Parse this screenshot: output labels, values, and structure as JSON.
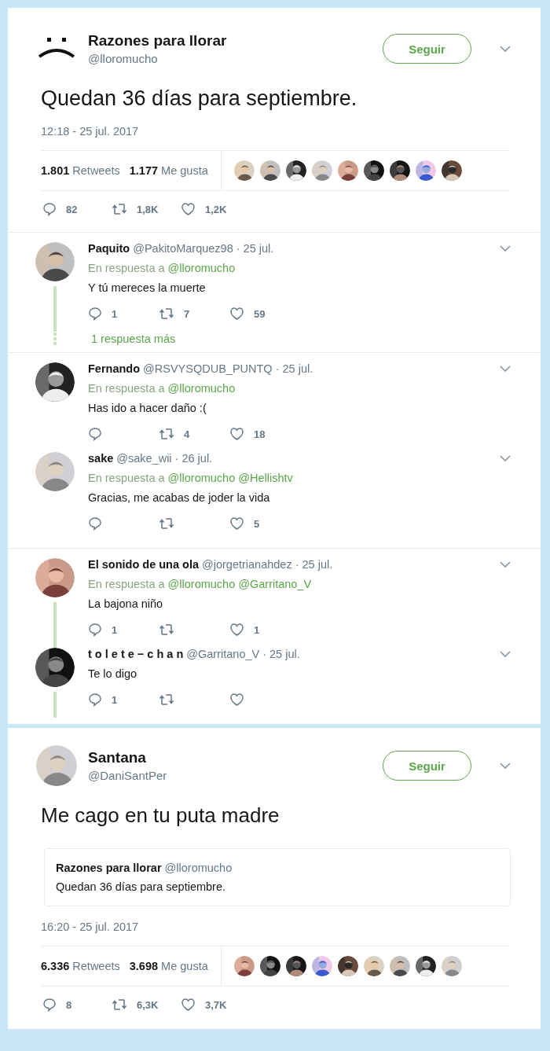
{
  "main_tweet": {
    "name": "Razones para llorar",
    "handle": "@lloromucho",
    "follow_button": "Seguir",
    "avatar": {
      "kind": "sad-face"
    },
    "text": "Quedan 36 días para septiembre.",
    "timestamp": "12:18 - 25 jul. 2017",
    "retweets_count": "1.801",
    "retweets_label": "Retweets",
    "likes_count": "1.177",
    "likes_label": "Me gusta",
    "actions": {
      "replies": "82",
      "retweets": "1,8K",
      "likes": "1,2K"
    }
  },
  "reply_groups": [
    {
      "tweets": [
        {
          "name": "Paquito",
          "handle": "@PakitoMarquez98",
          "date": "· 25 jul.",
          "reply_to_label": "En respuesta a",
          "reply_to": [
            "@lloromucho"
          ],
          "text": "Y tú mereces la muerte",
          "actions": {
            "replies": "1",
            "retweets": "7",
            "likes": "59"
          },
          "thread_line": true
        }
      ],
      "more_replies": "1 respuesta más"
    },
    {
      "tweets": [
        {
          "name": "Fernando",
          "handle": "@RSVYSQDUB_PUNTQ",
          "date": "· 25 jul.",
          "reply_to_label": "En respuesta a",
          "reply_to": [
            "@lloromucho"
          ],
          "text": "Has ido a hacer daño :(",
          "actions": {
            "retweets": "4",
            "likes": "18"
          },
          "thread_line": false
        },
        {
          "name": "sake",
          "handle": "@sake_wii",
          "date": "· 26 jul.",
          "reply_to_label": "En respuesta a",
          "reply_to": [
            "@lloromucho",
            "@Hellishtv"
          ],
          "text": "Gracias, me acabas de joder la vida",
          "actions": {
            "likes": "5"
          },
          "thread_line": false
        }
      ]
    },
    {
      "tweets": [
        {
          "name": "El sonido de una ola",
          "handle": "@jorgetrianahdez",
          "date": "· 25 jul.",
          "reply_to_label": "En respuesta a",
          "reply_to": [
            "@lloromucho",
            "@Garritano_V"
          ],
          "text": "La bajona niño",
          "actions": {
            "replies": "1",
            "likes": "1"
          },
          "thread_line": true
        },
        {
          "name": "t o l e t e − c h a n",
          "handle": "@Garritano_V",
          "date": "· 25 jul.",
          "text": "Te lo digo",
          "actions": {
            "replies": "1"
          },
          "thread_line": true
        }
      ]
    }
  ],
  "quote_tweet": {
    "name": "Santana",
    "handle": "@DaniSantPer",
    "follow_button": "Seguir",
    "text": "Me cago en tu puta madre",
    "quoted": {
      "name": "Razones para llorar",
      "handle": "@lloromucho",
      "text": "Quedan 36 días para septiembre."
    },
    "timestamp": "16:20 - 25 jul. 2017",
    "retweets_count": "6.336",
    "retweets_label": "Retweets",
    "likes_count": "3.698",
    "likes_label": "Me gusta",
    "actions": {
      "replies": "8",
      "retweets": "6,3K",
      "likes": "3,7K"
    }
  }
}
